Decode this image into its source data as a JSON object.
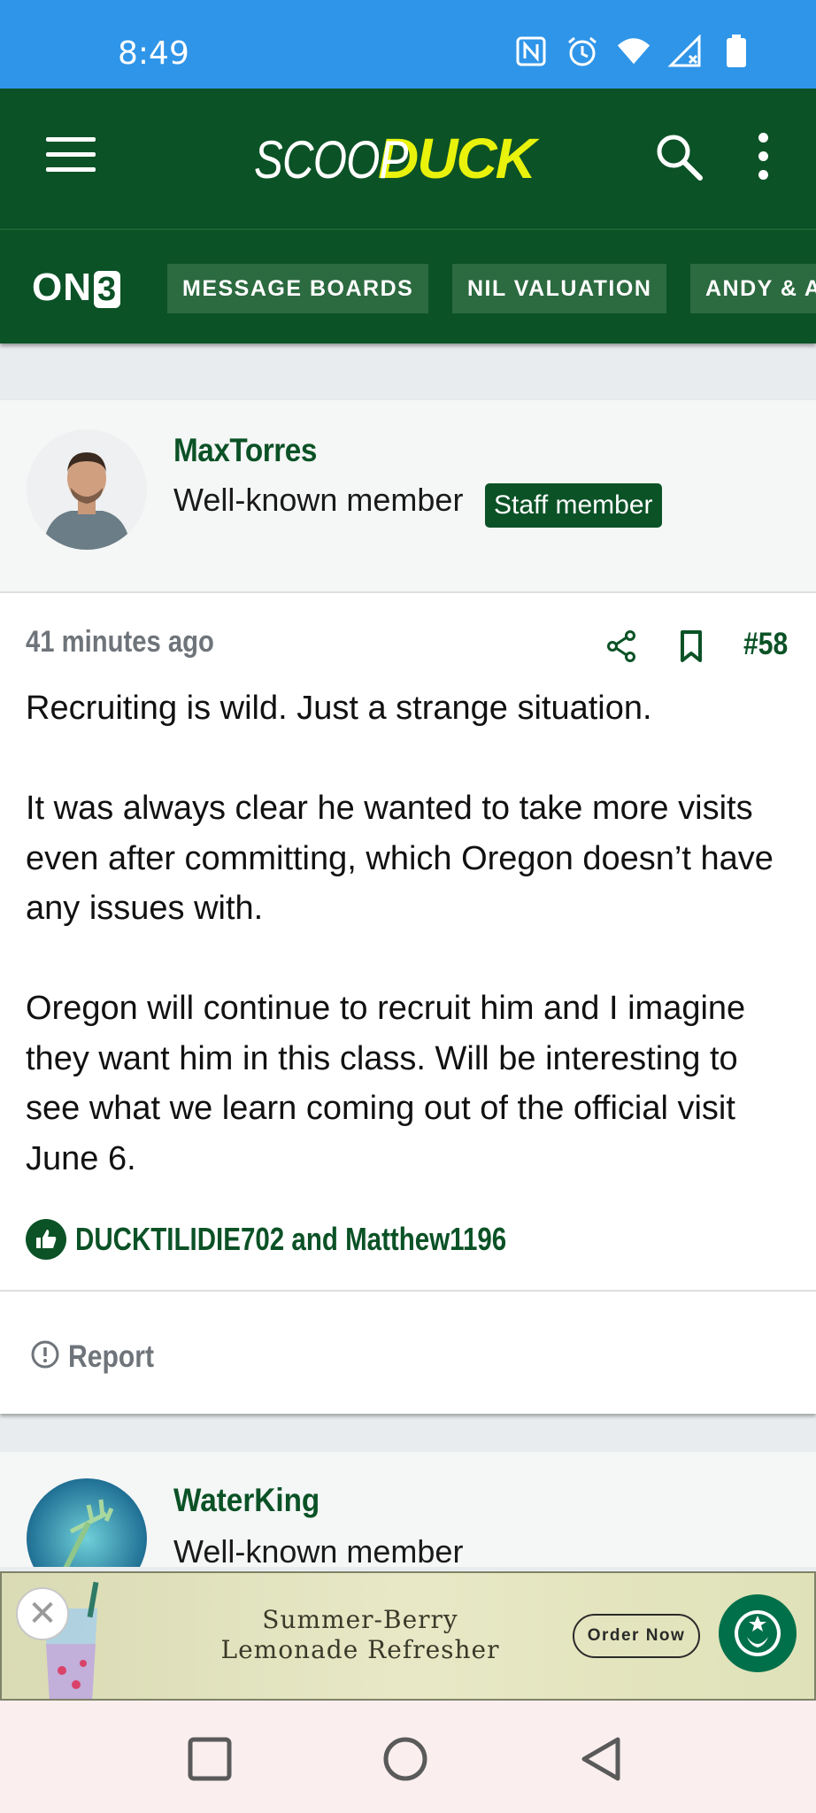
{
  "status_bar": {
    "time": "8:49",
    "icons": [
      "nfc-icon",
      "alarm-icon",
      "wifi-icon",
      "signal-icon",
      "battery-icon"
    ]
  },
  "app_bar": {
    "logo_part1": "SCOOP",
    "logo_part2": "DUCK",
    "menu_icon": "hamburger-icon",
    "search_icon": "search-icon",
    "more_icon": "more-vertical-icon"
  },
  "sub_nav": {
    "brand": "ON",
    "brand_digit": "3",
    "items": [
      {
        "label": "MESSAGE BOARDS"
      },
      {
        "label": "NIL VALUATION"
      },
      {
        "label": "ANDY & A"
      }
    ]
  },
  "post": {
    "author": "MaxTorres",
    "user_title": "Well-known member",
    "badge": "Staff member",
    "timestamp": "41 minutes ago",
    "post_number": "#58",
    "paragraphs": [
      "Recruiting is wild. Just a strange situation.",
      "It was always clear he wanted to take more visits even after committing, which Oregon doesn’t have any issues with.",
      "Oregon will continue to recruit him and I imagine they want him in this class. Will be interesting to see what we learn coming out of the official visit June 6."
    ],
    "likes_text": "DUCKTILIDIE702 and Matthew1196",
    "report_label": "Report"
  },
  "next_post": {
    "author": "WaterKing",
    "user_title": "Well-known member"
  },
  "ad": {
    "line1": "Summer-Berry",
    "line2": "Lemonade Refresher",
    "cta": "Order Now",
    "close": "✕"
  },
  "colors": {
    "status_bar": "#2f95e8",
    "brand_green": "#0b5226",
    "logo_yellow": "#e8f20b"
  }
}
